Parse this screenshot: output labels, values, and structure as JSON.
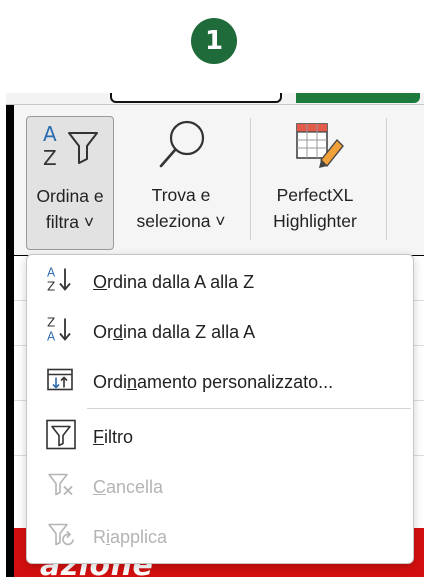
{
  "step_badge": "1",
  "ribbon": {
    "sort_filter": {
      "line1": "Ordina e",
      "line2": "filtra ˅",
      "icon": "sort-az-filter-icon"
    },
    "find_select": {
      "line1": "Trova e",
      "line2": "seleziona ˅",
      "icon": "magnifier-icon"
    },
    "perfectxl": {
      "line1": "PerfectXL",
      "line2": "Highlighter",
      "icon": "table-highlighter-icon"
    }
  },
  "menu": {
    "items": [
      {
        "label": "Ordina dalla A alla Z",
        "accel": "O",
        "icon": "sort-a-to-z-icon",
        "enabled": true
      },
      {
        "label": "Ordina dalla Z alla A",
        "accel": "d",
        "icon": "sort-z-to-a-icon",
        "enabled": true
      },
      {
        "label": "Ordinamento personalizzato...",
        "accel": "n",
        "icon": "custom-sort-icon",
        "enabled": true
      },
      {
        "label": "Filtro",
        "accel": "F",
        "icon": "filter-icon",
        "enabled": true
      },
      {
        "label": "Cancella",
        "accel": "C",
        "icon": "clear-filter-icon",
        "enabled": false
      },
      {
        "label": "Riapplica",
        "accel": "i",
        "icon": "reapply-filter-icon",
        "enabled": false
      }
    ]
  },
  "sheet": {
    "red_banner_text": "azione"
  },
  "colors": {
    "badge": "#1f6b3a",
    "green_tab": "#1e7a3c",
    "sheet_red": "#d40f0f",
    "disabled_text": "#b4b4b4",
    "arrow_blue": "#2b6cb0"
  }
}
